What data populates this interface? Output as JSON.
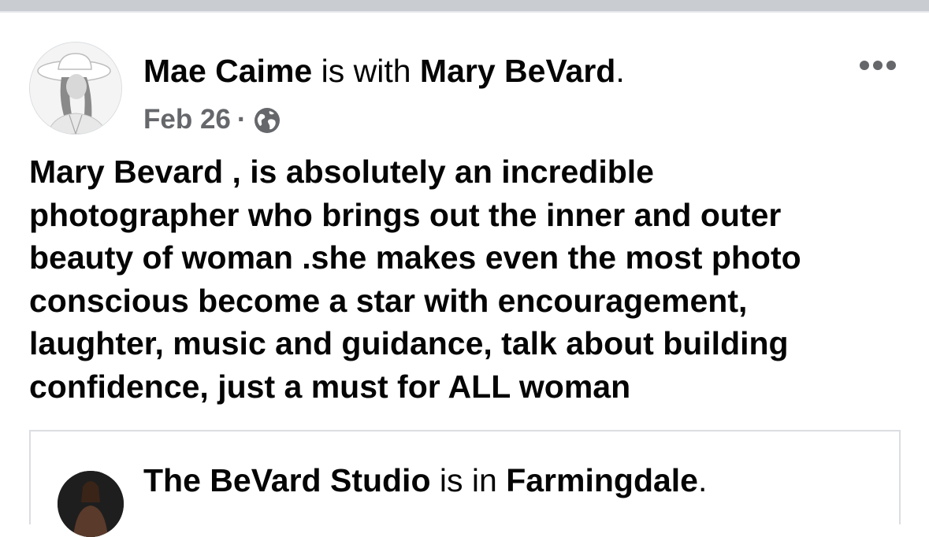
{
  "post": {
    "author": "Mae Caime",
    "with_text": " is with ",
    "tagged": "Mary BeVard",
    "period": ".",
    "date": "Feb 26",
    "separator": "·",
    "privacy_icon": "globe-icon",
    "more_icon": "more-options-icon",
    "body": "Mary Bevard , is absolutely an incredible\nphotographer who brings out the inner and outer\nbeauty of woman .she makes even the most photo\nconscious become a star with encouragement,\nlaughter, music and guidance, talk about building\nconfidence, just a must for ALL woman"
  },
  "shared": {
    "page_name": "The BeVard Studio",
    "in_text": " is in ",
    "location": "Farmingdale",
    "period": "."
  },
  "colors": {
    "text": "#050505",
    "secondary": "#65676b",
    "divider": "#dadde1",
    "top_bar": "#c9ccd1"
  }
}
